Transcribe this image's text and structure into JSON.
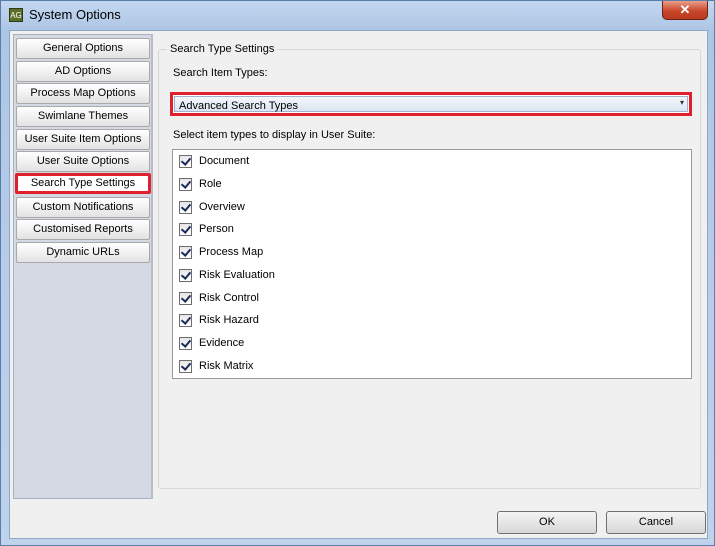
{
  "window": {
    "title": "System Options",
    "icon": "app-icon",
    "close_label": "✕"
  },
  "sidebar": {
    "items": [
      {
        "label": "General Options"
      },
      {
        "label": "AD Options"
      },
      {
        "label": "Process Map Options"
      },
      {
        "label": "Swimlane Themes"
      },
      {
        "label": "User Suite Item Options"
      },
      {
        "label": "User Suite Options"
      },
      {
        "label": "Search Type Settings",
        "selected": true
      },
      {
        "label": "Custom Notifications"
      },
      {
        "label": "Customised Reports"
      },
      {
        "label": "Dynamic URLs"
      }
    ]
  },
  "panel": {
    "group_title": "Search Type Settings",
    "search_item_types_label": "Search Item Types:",
    "search_item_types_value": "Advanced Search Types",
    "display_label": "Select item types to display in User Suite:",
    "item_types": [
      {
        "label": "Document",
        "checked": true
      },
      {
        "label": "Role",
        "checked": true
      },
      {
        "label": "Overview",
        "checked": true
      },
      {
        "label": "Person",
        "checked": true
      },
      {
        "label": "Process Map",
        "checked": true
      },
      {
        "label": "Risk Evaluation",
        "checked": true
      },
      {
        "label": "Risk Control",
        "checked": true
      },
      {
        "label": "Risk Hazard",
        "checked": true
      },
      {
        "label": "Evidence",
        "checked": true
      },
      {
        "label": "Risk Matrix",
        "checked": true
      }
    ]
  },
  "footer": {
    "ok_label": "OK",
    "cancel_label": "Cancel"
  },
  "colors": {
    "highlight": "#e0202c",
    "title_bar": "#aec6e6",
    "sidebar_bg": "#d5d9e4"
  }
}
